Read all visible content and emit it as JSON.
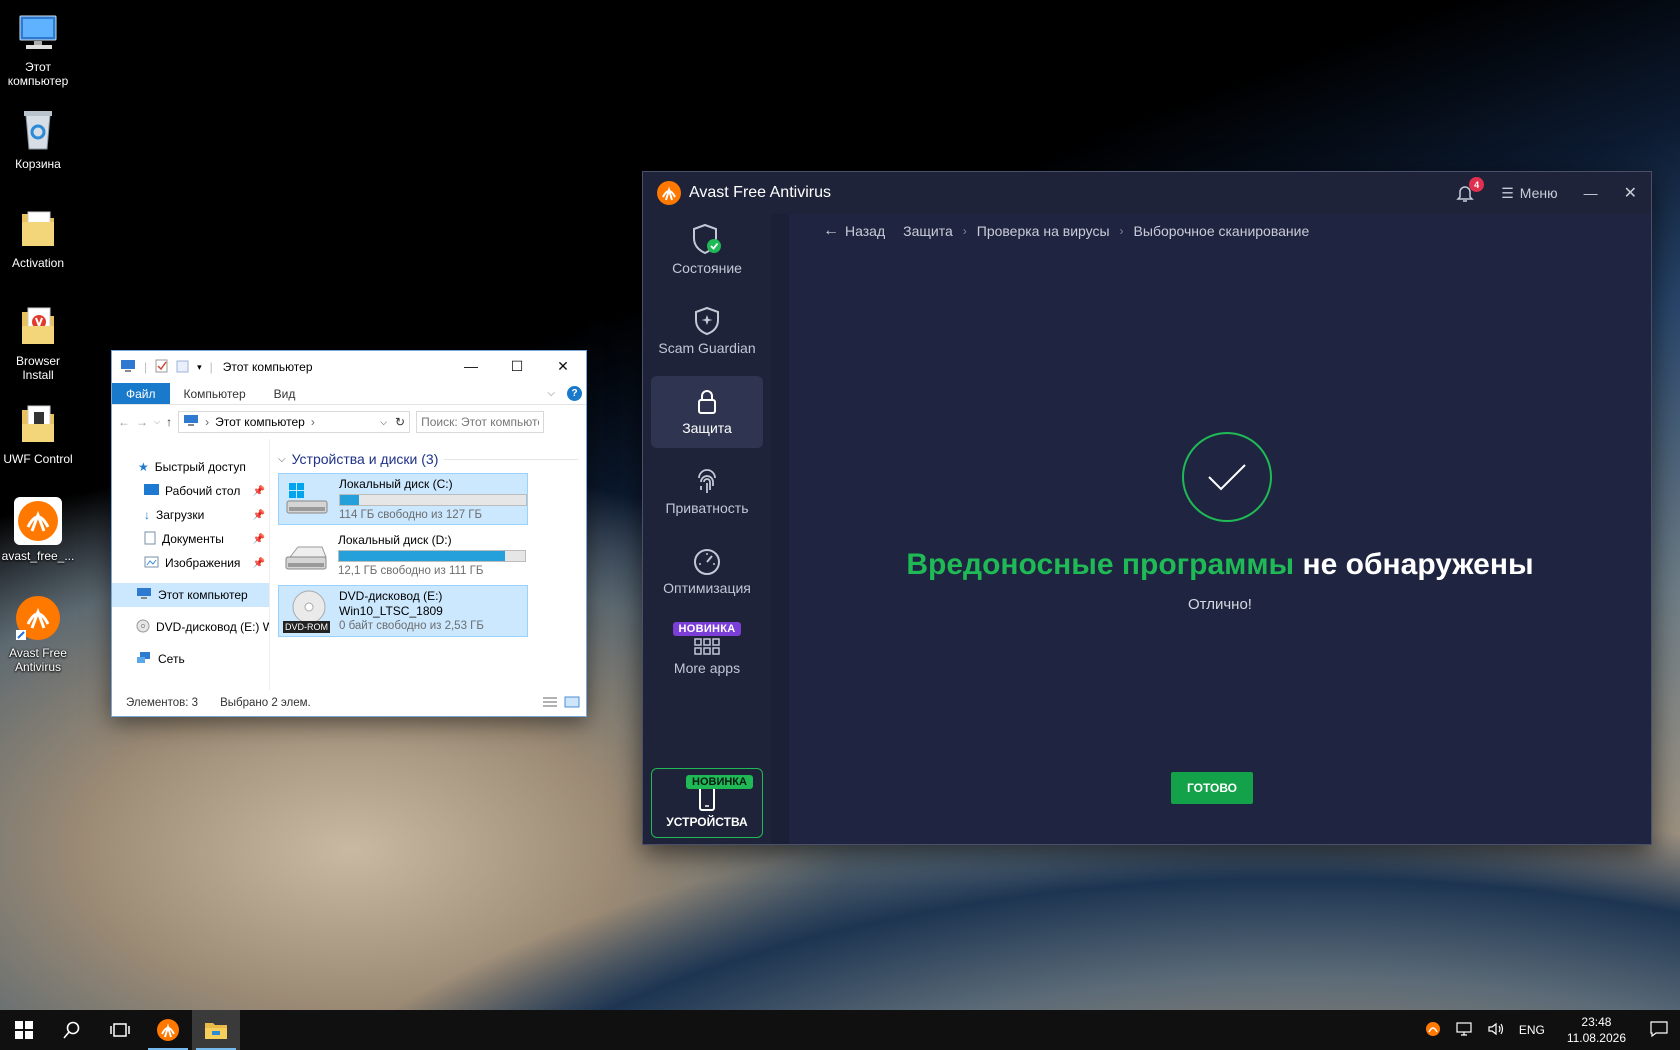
{
  "desktop": {
    "icons": [
      {
        "label": "Этот компьютер",
        "icon": "computer-icon"
      },
      {
        "label": "Корзина",
        "icon": "recycle-bin-icon"
      },
      {
        "label": "Activation",
        "icon": "folder-icon"
      },
      {
        "label": "Browser Install",
        "icon": "folder-app-icon"
      },
      {
        "label": "UWF Control",
        "icon": "folder-app-icon"
      },
      {
        "label": "avast_free_...",
        "icon": "avast-installer-icon"
      },
      {
        "label": "Avast Free Antivirus",
        "icon": "avast-shortcut-icon"
      }
    ]
  },
  "explorer": {
    "title": "Этот компьютер",
    "ribbon": {
      "file": "Файл",
      "computer": "Компьютер",
      "view": "Вид",
      "help": "?"
    },
    "address": "Этот компьютер",
    "search_placeholder": "Поиск: Этот компьютер",
    "nav": {
      "quick_access": "Быстрый доступ",
      "desktop": "Рабочий стол",
      "downloads": "Загрузки",
      "documents": "Документы",
      "pictures": "Изображения",
      "this_pc": "Этот компьютер",
      "dvd": "DVD-дисковод (E:) W",
      "network": "Сеть"
    },
    "group_header": "Устройства и диски (3)",
    "drives": [
      {
        "name": "Локальный диск (C:)",
        "free": "114 ГБ свободно из 127 ГБ",
        "used_fraction": 0.1
      },
      {
        "name": "Локальный диск (D:)",
        "free": "12,1 ГБ свободно из 111 ГБ",
        "used_fraction": 0.89
      },
      {
        "name": "DVD-дисковод (E:)",
        "label": "Win10_LTSC_1809",
        "free": "0 байт свободно из 2,53 ГБ",
        "badge": "DVD-ROM"
      }
    ],
    "status": {
      "items": "Элементов: 3",
      "selected": "Выбрано 2 элем."
    }
  },
  "avast": {
    "title": "Avast Free Antivirus",
    "notifications": "4",
    "menu": "Меню",
    "sidebar": {
      "status": "Состояние",
      "scam_guardian": "Scam Guardian",
      "protection": "Защита",
      "privacy": "Приватность",
      "optimization": "Оптимизация",
      "new_badge": "НОВИНКА",
      "more_apps": "More apps",
      "devices_badge": "НОВИНКА",
      "devices": "УСТРОЙСТВА"
    },
    "breadcrumb": {
      "back": "Назад",
      "protection": "Защита",
      "virus_scan": "Проверка на вирусы",
      "custom_scan": "Выборочное сканирование"
    },
    "result": {
      "headline_green": "Вредоносные программы",
      "headline_white": "не обнаружены",
      "subtitle": "Отлично!",
      "done_button": "ГОТОВО"
    },
    "colors": {
      "accent_green": "#1fb955",
      "bg": "#1e2339",
      "brand_orange": "#ff7800"
    }
  },
  "taskbar": {
    "language": "ENG",
    "time": "23:48",
    "date": "11.08.2026"
  }
}
